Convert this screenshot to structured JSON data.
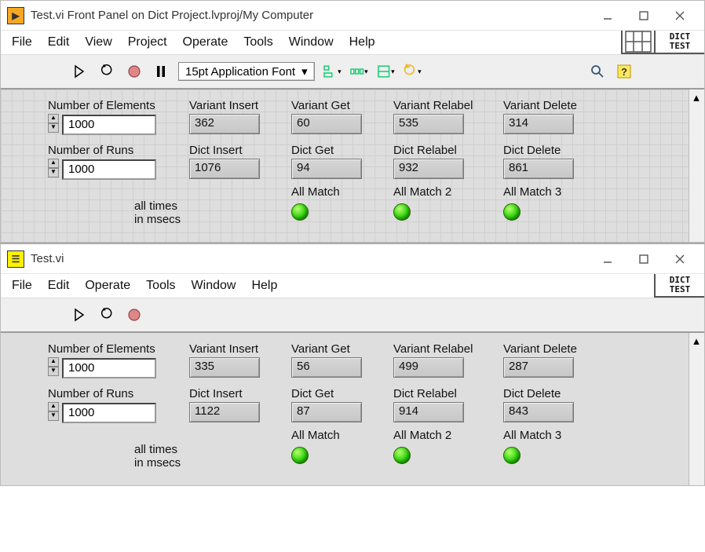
{
  "win1": {
    "title": "Test.vi Front Panel on Dict Project.lvproj/My Computer",
    "menus": [
      "File",
      "Edit",
      "View",
      "Project",
      "Operate",
      "Tools",
      "Window",
      "Help"
    ],
    "font": "15pt Application Font",
    "badge": "DICT\nTEST",
    "panel": {
      "num_elements_label": "Number of Elements",
      "num_elements": "1000",
      "num_runs_label": "Number of Runs",
      "num_runs": "1000",
      "times_note": "all times in msecs",
      "cols": {
        "variant_insert": {
          "label": "Variant Insert",
          "val": "362"
        },
        "variant_get": {
          "label": "Variant Get",
          "val": "60"
        },
        "variant_relabel": {
          "label": "Variant Relabel",
          "val": "535"
        },
        "variant_delete": {
          "label": "Variant Delete",
          "val": "314"
        },
        "dict_insert": {
          "label": "Dict Insert",
          "val": "1076"
        },
        "dict_get": {
          "label": "Dict Get",
          "val": "94"
        },
        "dict_relabel": {
          "label": "Dict Relabel",
          "val": "932"
        },
        "dict_delete": {
          "label": "Dict Delete",
          "val": "861"
        }
      },
      "leds": {
        "m1": "All Match",
        "m2": "All Match 2",
        "m3": "All Match 3"
      }
    }
  },
  "win2": {
    "title": "Test.vi",
    "menus": [
      "File",
      "Edit",
      "Operate",
      "Tools",
      "Window",
      "Help"
    ],
    "badge": "DICT\nTEST",
    "panel": {
      "num_elements_label": "Number of Elements",
      "num_elements": "1000",
      "num_runs_label": "Number of Runs",
      "num_runs": "1000",
      "times_note": "all times in msecs",
      "cols": {
        "variant_insert": {
          "label": "Variant Insert",
          "val": "335"
        },
        "variant_get": {
          "label": "Variant Get",
          "val": "56"
        },
        "variant_relabel": {
          "label": "Variant Relabel",
          "val": "499"
        },
        "variant_delete": {
          "label": "Variant Delete",
          "val": "287"
        },
        "dict_insert": {
          "label": "Dict Insert",
          "val": "1122"
        },
        "dict_get": {
          "label": "Dict Get",
          "val": "87"
        },
        "dict_relabel": {
          "label": "Dict Relabel",
          "val": "914"
        },
        "dict_delete": {
          "label": "Dict Delete",
          "val": "843"
        }
      },
      "leds": {
        "m1": "All Match",
        "m2": "All Match 2",
        "m3": "All Match 3"
      }
    }
  }
}
